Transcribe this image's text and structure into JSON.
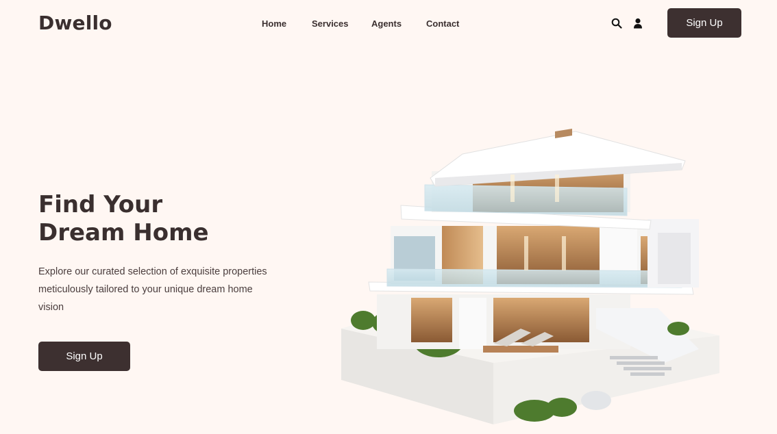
{
  "brand": {
    "logo_text": "Dwello"
  },
  "nav": {
    "items": [
      {
        "label": "Home"
      },
      {
        "label": "Services"
      },
      {
        "label": "Agents"
      },
      {
        "label": "Contact"
      }
    ]
  },
  "header": {
    "icons": [
      "search-icon",
      "user-icon"
    ],
    "signup_label": "Sign Up"
  },
  "hero": {
    "title_line1": "Find Your",
    "title_line2": "Dream Home",
    "description": "Explore our curated selection of exquisite properties meticulously tailored to your unique dream home vision",
    "cta_label": "Sign Up",
    "image_alt": "modern-house-illustration"
  },
  "colors": {
    "background": "#fff7f3",
    "primary": "#3d3030",
    "text": "#3a2f2f",
    "button_text": "#ffffff"
  }
}
